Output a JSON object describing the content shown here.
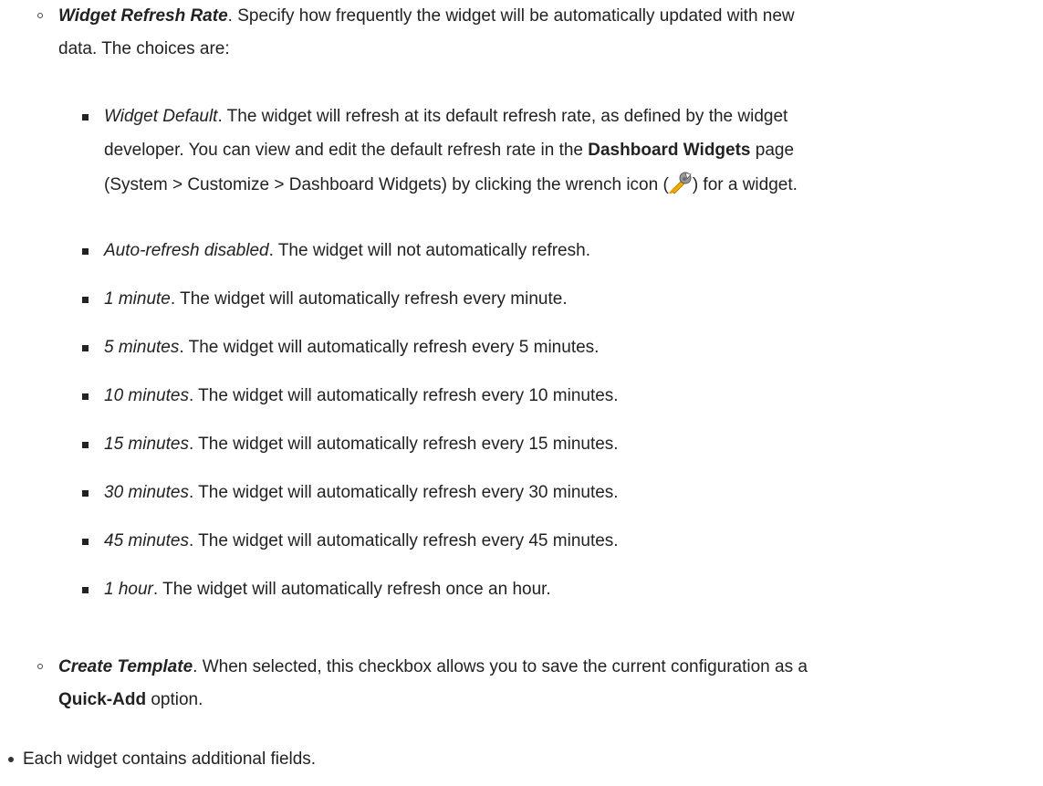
{
  "refresh_rate": {
    "term": "Widget Refresh Rate",
    "line1": ". Specify how frequently the widget will be automatically updated with new",
    "line2": "data. The choices are:"
  },
  "options": {
    "widget_default": {
      "term": "Widget Default",
      "line1": ". The widget will refresh at its default refresh rate, as defined by the widget",
      "line2_pre": "developer. You can view and edit the default refresh rate in the ",
      "line2_link": "Dashboard Widgets",
      "line2_post": " page",
      "line3_pre": "(System > Customize > Dashboard Widgets) by clicking the wrench icon (",
      "line3_post": ") for a widget."
    },
    "items": [
      {
        "term": "Auto-refresh disabled",
        "text": ". The widget will not automatically refresh."
      },
      {
        "term": "1 minute",
        "text": ". The widget will automatically refresh every minute."
      },
      {
        "term": "5 minutes",
        "text": ". The widget will automatically refresh every 5 minutes."
      },
      {
        "term": "10 minutes",
        "text": ". The widget will automatically refresh every 10 minutes."
      },
      {
        "term": "15 minutes",
        "text": ". The widget will automatically refresh every 15 minutes."
      },
      {
        "term": "30 minutes",
        "text": ". The widget will automatically refresh every 30 minutes."
      },
      {
        "term": "45 minutes",
        "text": ". The widget will automatically refresh every 45 minutes."
      },
      {
        "term": "1 hour",
        "text": ". The widget will automatically refresh once an hour."
      }
    ]
  },
  "create_template": {
    "term": "Create Template",
    "line1": ". When selected, this checkbox allows you to save the current configuration as a",
    "line2_link": "Quick-Add",
    "line2_post": " option."
  },
  "final_bullet": "Each widget contains additional fields.",
  "icons": {
    "wrench": "wrench-icon"
  }
}
